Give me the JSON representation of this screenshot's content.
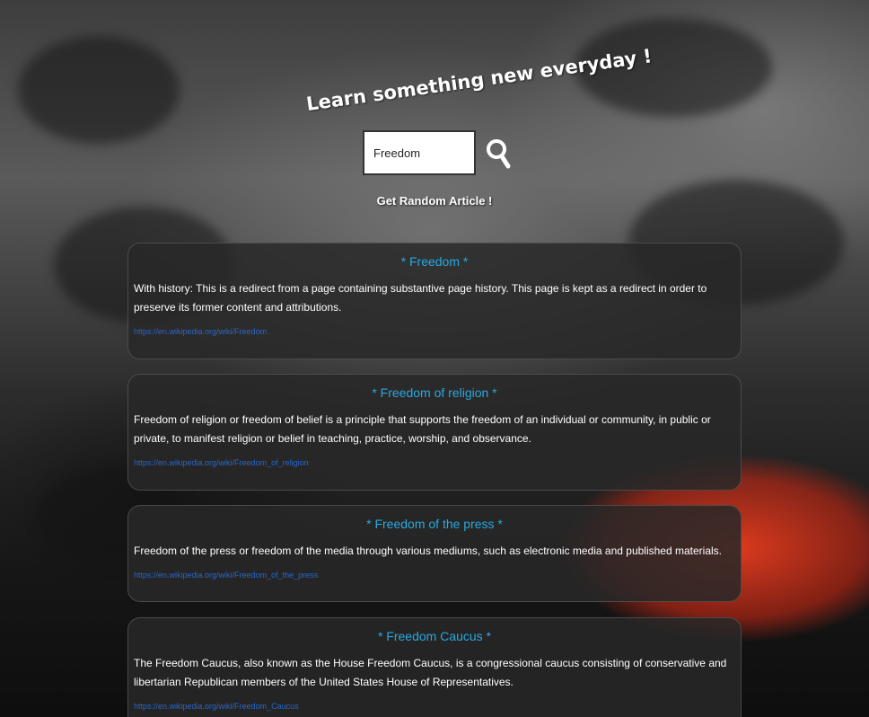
{
  "header": {
    "title": "Learn something new everyday !"
  },
  "search": {
    "value": "Freedom",
    "button_icon": "search-icon"
  },
  "random_link": "Get Random Article !",
  "results": [
    {
      "title": "* Freedom *",
      "extract": "With history: This is a redirect from a page containing substantive page history. This page is kept as a redirect in order to preserve its former content and attributions.",
      "url": "https://en.wikipedia.org/wiki/Freedom"
    },
    {
      "title": "* Freedom of religion *",
      "extract": "Freedom of religion or freedom of belief is a principle that supports the freedom of an individual or community, in public or private, to manifest religion or belief in teaching, practice, worship, and observance.",
      "url": "https://en.wikipedia.org/wiki/Freedom_of_religion"
    },
    {
      "title": "* Freedom of the press *",
      "extract": "Freedom of the press or freedom of the media through various mediums, such as electronic media and published materials.",
      "url": "https://en.wikipedia.org/wiki/Freedom_of_the_press"
    },
    {
      "title": "* Freedom Caucus *",
      "extract": "The Freedom Caucus, also known as the House Freedom Caucus, is a congressional caucus consisting of conservative and libertarian Republican members of the United States House of Representatives.",
      "url": "https://en.wikipedia.org/wiki/Freedom_Caucus"
    }
  ],
  "colors": {
    "title_link": "#29a8e0",
    "url_link": "#2a66c8",
    "card_bg": "#282828"
  }
}
